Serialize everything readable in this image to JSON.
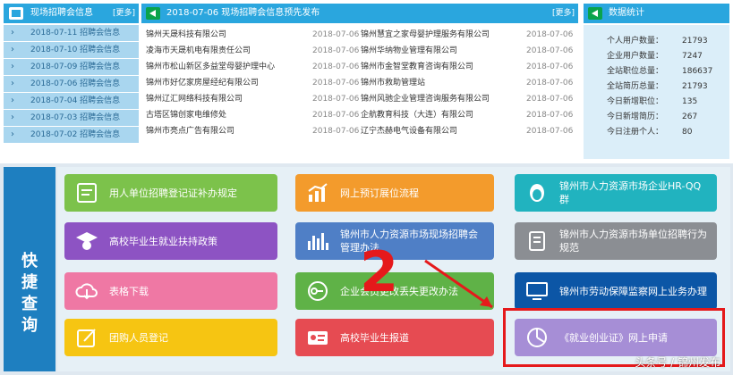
{
  "left_panel": {
    "title": "现场招聘会信息",
    "more": "[更多]",
    "items": [
      "2018-07-11 招聘会信息",
      "2018-07-10 招聘会信息",
      "2018-07-09 招聘会信息",
      "2018-07-06 招聘会信息",
      "2018-07-04 招聘会信息",
      "2018-07-03 招聘会信息",
      "2018-07-02 招聘会信息"
    ]
  },
  "mid_panel": {
    "title": "2018-07-06 现场招聘会信息预先发布",
    "more": "[更多]",
    "rows": [
      {
        "c1": "锦州天晟科技有限公司",
        "d1": "2018-07-06",
        "c2": "锦州慧宜之家母婴护理服务有限公司",
        "d2": "2018-07-06"
      },
      {
        "c1": "凌海市天晟机电有限责任公司",
        "d1": "2018-07-06",
        "c2": "锦州华纳物业管理有限公司",
        "d2": "2018-07-06"
      },
      {
        "c1": "锦州市松山新区多益堂母婴护理中心",
        "d1": "2018-07-06",
        "c2": "锦州市金智堂教育咨询有限公司",
        "d2": "2018-07-06"
      },
      {
        "c1": "锦州市好亿家房屋经纪有限公司",
        "d1": "2018-07-06",
        "c2": "锦州市救助管理站",
        "d2": "2018-07-06"
      },
      {
        "c1": "锦州辽汇网络科技有限公司",
        "d1": "2018-07-06",
        "c2": "锦州风驰企业管理咨询服务有限公司",
        "d2": "2018-07-06"
      },
      {
        "c1": "古塔区锦创家电维修处",
        "d1": "2018-07-06",
        "c2": "企航教育科技（大连）有限公司",
        "d2": "2018-07-06"
      },
      {
        "c1": "锦州市亮点广告有限公司",
        "d1": "2018-07-06",
        "c2": "辽宁杰赫电气设备有限公司",
        "d2": "2018-07-06"
      }
    ]
  },
  "stats_panel": {
    "title": "数据统计",
    "items": [
      {
        "k": "个人用户数量：",
        "v": "21793"
      },
      {
        "k": "企业用户数量：",
        "v": "7247"
      },
      {
        "k": "全站职位总量：",
        "v": "186637"
      },
      {
        "k": "全站简历总量：",
        "v": "21793"
      },
      {
        "k": "今日新增职位：",
        "v": "135"
      },
      {
        "k": "今日新增简历：",
        "v": "267"
      },
      {
        "k": "今日注册个人：",
        "v": "80"
      }
    ]
  },
  "quick": {
    "side_label": [
      "快",
      "捷",
      "查",
      "询"
    ],
    "tiles": {
      "t1": "用人单位招聘登记证补办规定",
      "t2": "网上预订展位流程",
      "t3": "锦州市人力资源市场企业HR-QQ群",
      "t4": "高校毕业生就业扶持政策",
      "t5": "锦州市人力资源市场现场招聘会管理办法",
      "t6": "锦州市人力资源市场单位招聘行为规范",
      "t7": "表格下载",
      "t8": "企业会员更改丢失更改办法",
      "t9": "锦州市劳动保障监察网上业务办理",
      "t10": "团购人员登记",
      "t11": "高校毕业生报道",
      "t12": "《就业创业证》网上申请"
    }
  },
  "annotation": {
    "number": "2"
  },
  "watermark": "头条号 / 锦州发布"
}
